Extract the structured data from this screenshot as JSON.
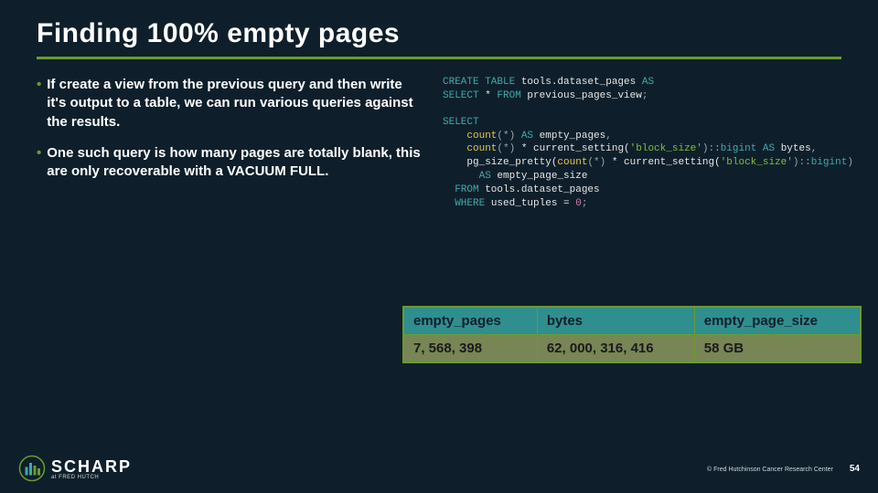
{
  "title": "Finding 100% empty pages",
  "bullets": [
    "If create a view from the previous query and then write it's output to a table, we can run various queries against the results.",
    "One such query is how many pages are totally blank, this are only recoverable with a VACUUM FULL."
  ],
  "code_block1": {
    "l1a": "CREATE TABLE",
    "l1b": " tools.dataset_pages ",
    "l1c": "AS",
    "l2a": "SELECT",
    "l2b": " * ",
    "l2c": "FROM",
    "l2d": " previous_pages_view",
    "l2e": ";"
  },
  "code_block2": {
    "l1": "SELECT",
    "l2a": "    count",
    "l2b": "(*)",
    "l2c": " AS",
    "l2d": " empty_pages",
    "l2e": ",",
    "l3a": "    count",
    "l3b": "(*)",
    "l3c": " * current_setting(",
    "l3d": "'block_size'",
    "l3e": ")",
    "l3f": "::",
    "l3g": "bigint ",
    "l3h": "AS",
    "l3i": " bytes",
    "l3j": ",",
    "l4a": "    pg_size_pretty(",
    "l4b": "count",
    "l4c": "(*)",
    "l4d": " * current_setting(",
    "l4e": "'block_size'",
    "l4f": ")",
    "l4g": "::",
    "l4h": "bigint",
    "l4i": ")",
    "l5a": "      AS",
    "l5b": " empty_page_size",
    "l6a": "  FROM",
    "l6b": " tools.dataset_pages",
    "l7a": "  WHERE",
    "l7b": " used_tuples = ",
    "l7c": "0",
    "l7d": ";"
  },
  "table": {
    "headers": [
      "empty_pages",
      "bytes",
      "empty_page_size"
    ],
    "row": [
      "7, 568, 398",
      "62, 000, 316, 416",
      "58 GB"
    ]
  },
  "footer": {
    "logo_text": "SCHARP",
    "logo_sub": "at FRED HUTCH",
    "copyright": "© Fred Hutchinson Cancer Research Center",
    "page": "54"
  }
}
